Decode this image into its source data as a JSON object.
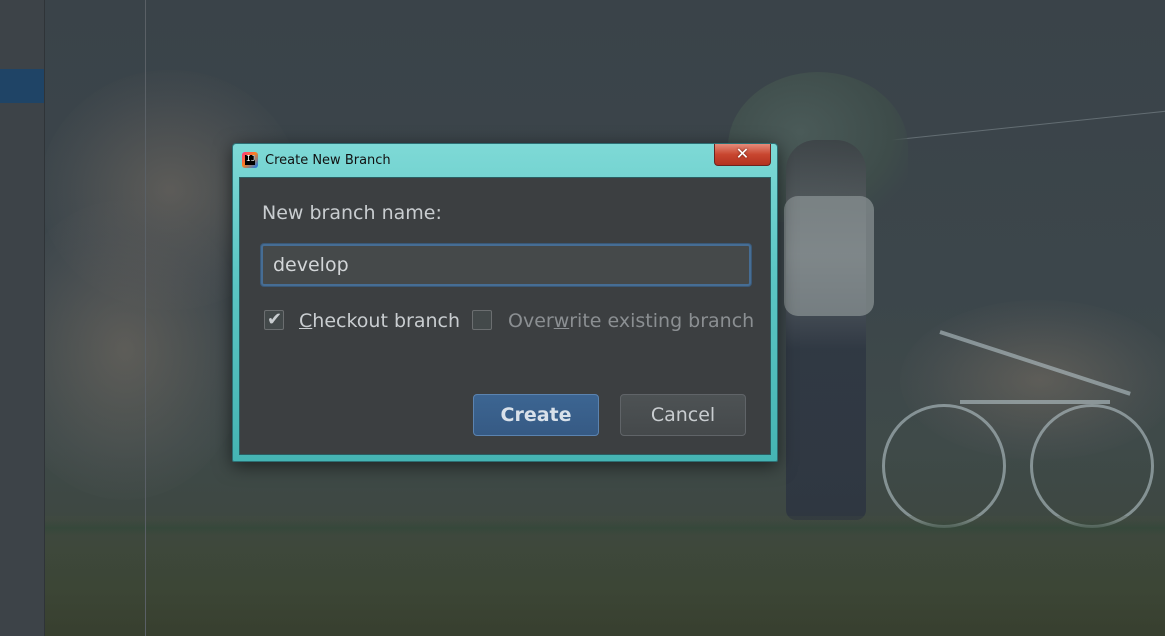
{
  "dialog": {
    "title": "Create New Branch",
    "close_glyph": "✕",
    "app_icon_text": "IJ",
    "branch_name_label": "New branch name:",
    "branch_name_value": "develop",
    "checkout_checkbox": {
      "label_mnemonic": "C",
      "label_rest": "heckout branch",
      "checked": true
    },
    "overwrite_checkbox": {
      "label_before": "Over",
      "label_mnemonic": "w",
      "label_after": "rite existing branch",
      "checked": false
    },
    "create_button_label": "Create",
    "cancel_button_label": "Cancel"
  },
  "colors": {
    "titlebar_accent": "#5cc6c4",
    "dialog_body": "#3c3f41",
    "primary_button": "#365a84",
    "input_focus_border": "#466d94",
    "close_button": "#c8462f"
  },
  "icons": {
    "app_icon": "intellij-idea-icon",
    "close": "close-icon",
    "check": "check-icon"
  }
}
